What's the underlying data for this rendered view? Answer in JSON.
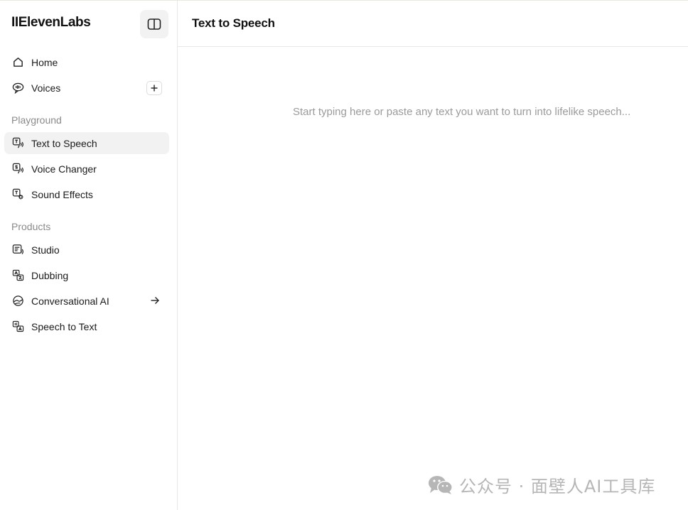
{
  "app": {
    "logo": "IIElevenLabs"
  },
  "sidebar": {
    "top_items": [
      {
        "label": "Home",
        "icon": "home-icon"
      },
      {
        "label": "Voices",
        "icon": "voices-icon"
      }
    ],
    "playground_label": "Playground",
    "playground_items": [
      {
        "label": "Text to Speech",
        "icon": "text-to-speech-icon",
        "active": true
      },
      {
        "label": "Voice Changer",
        "icon": "voice-changer-icon"
      },
      {
        "label": "Sound Effects",
        "icon": "sound-effects-icon"
      }
    ],
    "products_label": "Products",
    "product_items": [
      {
        "label": "Studio",
        "icon": "studio-icon"
      },
      {
        "label": "Dubbing",
        "icon": "dubbing-icon"
      },
      {
        "label": "Conversational AI",
        "icon": "conversational-ai-icon"
      },
      {
        "label": "Speech to Text",
        "icon": "speech-to-text-icon"
      }
    ]
  },
  "header": {
    "title": "Text to Speech"
  },
  "editor": {
    "placeholder": "Start typing here or paste any text you want to turn into lifelike speech..."
  },
  "watermark": {
    "text": "公众号 · 面壁人AI工具库"
  }
}
